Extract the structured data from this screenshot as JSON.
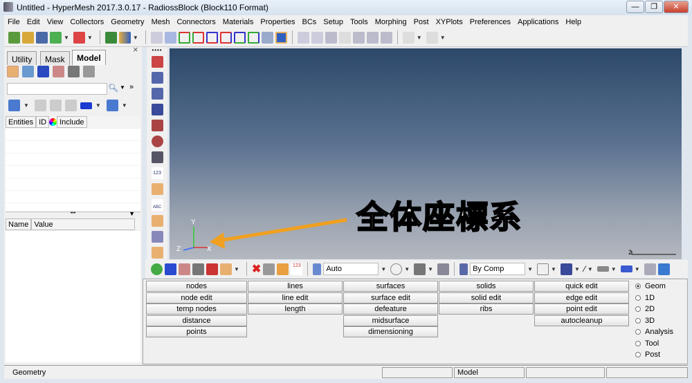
{
  "window": {
    "title": "Untitled - HyperMesh 2017.3.0.17 - RadiossBlock (Block110 Format)",
    "minimize": "—",
    "maximize": "❐",
    "close": "✕"
  },
  "menu": [
    "File",
    "Edit",
    "View",
    "Collectors",
    "Geometry",
    "Mesh",
    "Connectors",
    "Materials",
    "Properties",
    "BCs",
    "Setup",
    "Tools",
    "Morphing",
    "Post",
    "XYPlots",
    "Preferences",
    "Applications",
    "Help"
  ],
  "left_panel": {
    "tabs": [
      "Utility",
      "Mask",
      "Model"
    ],
    "active_tab": "Model",
    "close": "×",
    "search_placeholder": "",
    "columns": [
      "Entities",
      "ID",
      "Include"
    ],
    "attr_columns": [
      "Name",
      "Value"
    ]
  },
  "viewport": {
    "annotation": "全体座標系",
    "triad": {
      "y": "Y",
      "z": "Z",
      "x": "X"
    },
    "scale_label": "2",
    "annotation_color": "#f0a020"
  },
  "bottom_toolbar": {
    "display_mode": "Auto",
    "color_mode": "By Comp"
  },
  "panel": {
    "columns": [
      [
        "nodes",
        "node edit",
        "temp nodes",
        "distance",
        "points"
      ],
      [
        "lines",
        "line edit",
        "length"
      ],
      [
        "surfaces",
        "surface edit",
        "defeature",
        "midsurface",
        "dimensioning"
      ],
      [
        "solids",
        "solid edit",
        "ribs"
      ],
      [
        "quick edit",
        "edge edit",
        "point edit",
        "autocleanup"
      ]
    ],
    "modes": [
      "Geom",
      "1D",
      "2D",
      "3D",
      "Analysis",
      "Tool",
      "Post"
    ],
    "selected_mode": "Geom"
  },
  "status": {
    "left": "Geometry",
    "middle": "Model"
  }
}
